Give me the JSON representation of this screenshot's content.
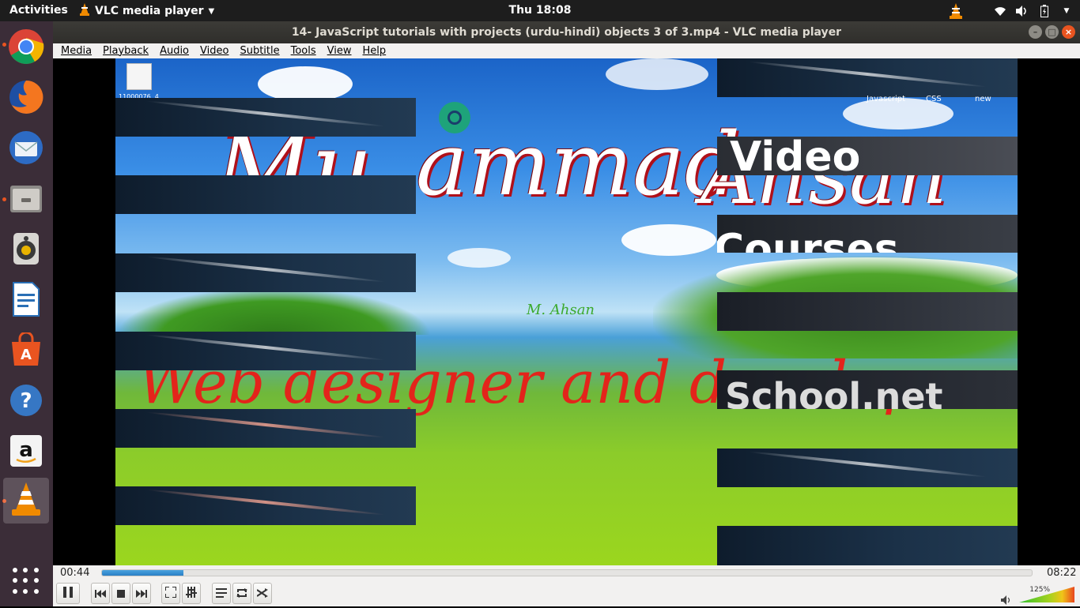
{
  "topbar": {
    "activities": "Activities",
    "app_name": "VLC media player",
    "clock": "Thu 18:08"
  },
  "dock": {
    "items": [
      {
        "name": "chrome-icon"
      },
      {
        "name": "firefox-icon"
      },
      {
        "name": "thunderbird-icon"
      },
      {
        "name": "files-icon"
      },
      {
        "name": "rhythmbox-icon"
      },
      {
        "name": "writer-icon"
      },
      {
        "name": "software-icon"
      },
      {
        "name": "help-icon"
      },
      {
        "name": "amazon-icon"
      },
      {
        "name": "vlc-icon"
      }
    ]
  },
  "window": {
    "title": "14- JavaScript tutorials with projects (urdu-hindi) objects 3 of 3.mp4 - VLC media player"
  },
  "menubar": {
    "items": [
      "Media",
      "Playback",
      "Audio",
      "Video",
      "Subtitle",
      "Tools",
      "View",
      "Help"
    ]
  },
  "video": {
    "title_part1": "Mu",
    "title_part2": "ammad",
    "title_part3": "Ahsan",
    "subtitle": "Web designer and developer",
    "panel_video": "Video",
    "panel_courses": "Courses",
    "panel_school": "School.net",
    "tab_javascript": "Javascript",
    "tab_css": "CSS",
    "tab_new": "new",
    "watermark": "M. Ahsan",
    "desktop_icon_label": "11000076..4"
  },
  "player": {
    "elapsed": "00:44",
    "duration": "08:22",
    "progress": 0.088,
    "volume_label": "125%",
    "volume": 1.25
  },
  "colors": {
    "accent": "#e95420",
    "seek": "#2a7fc4"
  }
}
